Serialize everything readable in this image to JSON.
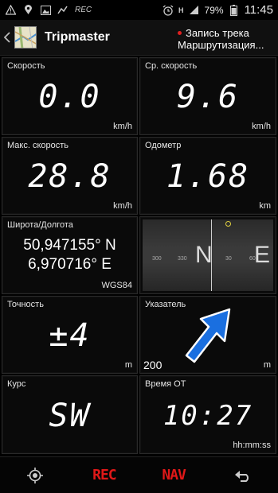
{
  "statusbar": {
    "rec_label": "REC",
    "network": "H",
    "battery": "79%",
    "time": "11:45"
  },
  "header": {
    "title": "Tripmaster",
    "menu_line1": "Запись трека",
    "menu_line2": "Маршрутизация..."
  },
  "tiles": {
    "speed": {
      "label": "Скорость",
      "value": "0.0",
      "unit": "km/h"
    },
    "avg_speed": {
      "label": "Ср. скорость",
      "value": "9.6",
      "unit": "km/h"
    },
    "max_speed": {
      "label": "Макс. скорость",
      "value": "28.8",
      "unit": "km/h"
    },
    "odometer": {
      "label": "Одометр",
      "value": "1.68",
      "unit": "km"
    },
    "position": {
      "label": "Широта/Долгота",
      "lat": "50,947155° N",
      "lon": "6,970716° E",
      "datum": "WGS84"
    },
    "compass": {
      "letter_n": "N",
      "letter_e": "E",
      "ticks": [
        "300",
        "330",
        "30",
        "60"
      ]
    },
    "accuracy": {
      "label": "Точность",
      "value": "±4",
      "unit": "m"
    },
    "pointer": {
      "label": "Указатель",
      "distance": "200",
      "unit": "m"
    },
    "course": {
      "label": "Курс",
      "value": "SW"
    },
    "time_ot": {
      "label": "Время ОТ",
      "value": "10:27",
      "unit": "hh:mm:ss"
    }
  },
  "bottombar": {
    "rec_label": "REC",
    "nav_label": "NAV"
  },
  "colors": {
    "accent_red": "#e01818",
    "arrow_blue": "#1a6fe0"
  }
}
